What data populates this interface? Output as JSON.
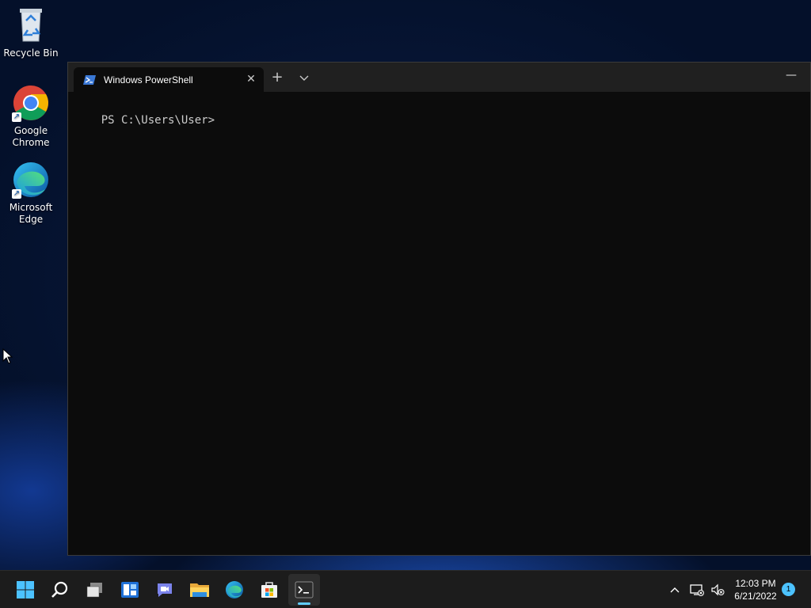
{
  "desktop": {
    "icons": [
      {
        "label": "Recycle Bin",
        "icon": "recycle-bin-icon"
      },
      {
        "label": "Google Chrome",
        "icon": "chrome-icon"
      },
      {
        "label": "Microsoft Edge",
        "icon": "edge-icon"
      }
    ]
  },
  "terminal": {
    "tab_label": "Windows PowerShell",
    "tab_icon": "powershell-icon",
    "new_tab_symbol": "+",
    "prompt": "PS C:\\Users\\User>"
  },
  "taskbar": {
    "apps": [
      {
        "name": "Start",
        "icon": "windows-start-icon"
      },
      {
        "name": "Search",
        "icon": "search-icon"
      },
      {
        "name": "Task View",
        "icon": "task-view-icon"
      },
      {
        "name": "Widgets",
        "icon": "widgets-icon"
      },
      {
        "name": "Chat",
        "icon": "teams-chat-icon"
      },
      {
        "name": "File Explorer",
        "icon": "file-explorer-icon"
      },
      {
        "name": "Microsoft Edge",
        "icon": "edge-icon"
      },
      {
        "name": "Microsoft Store",
        "icon": "store-icon"
      },
      {
        "name": "Terminal",
        "icon": "terminal-icon",
        "active": true
      }
    ],
    "tray": {
      "time": "12:03 PM",
      "date": "6/21/2022",
      "notification_count": "1"
    }
  },
  "colors": {
    "accent": "#60cdff",
    "taskbar_bg": "#1c1c1c",
    "terminal_bg": "#0c0c0c",
    "titlebar_bg": "#202020"
  }
}
